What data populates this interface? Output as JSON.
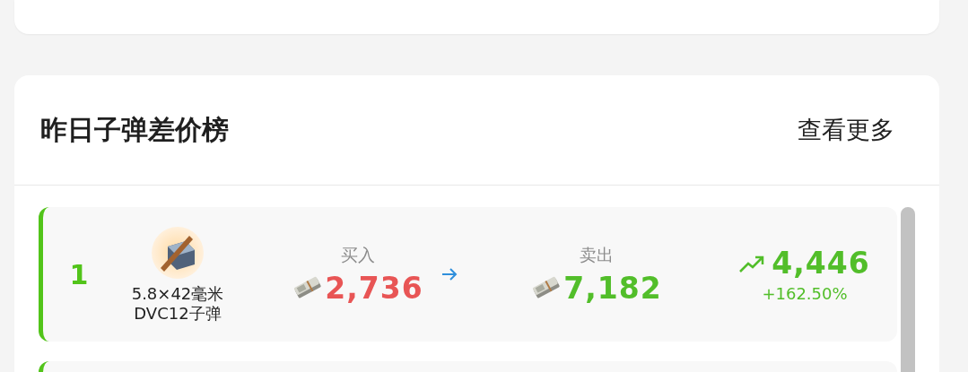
{
  "ranking": {
    "title": "昨日子弹差价榜",
    "more_link": "查看更多",
    "rows": [
      {
        "rank": "1",
        "item_name": "5.8×42毫米 DVC12子弹",
        "buy_label": "买入",
        "buy_price": "2,736",
        "sell_label": "卖出",
        "sell_price": "7,182",
        "profit": "4,446",
        "profit_percent": "+162.50%",
        "rising": true
      }
    ]
  }
}
